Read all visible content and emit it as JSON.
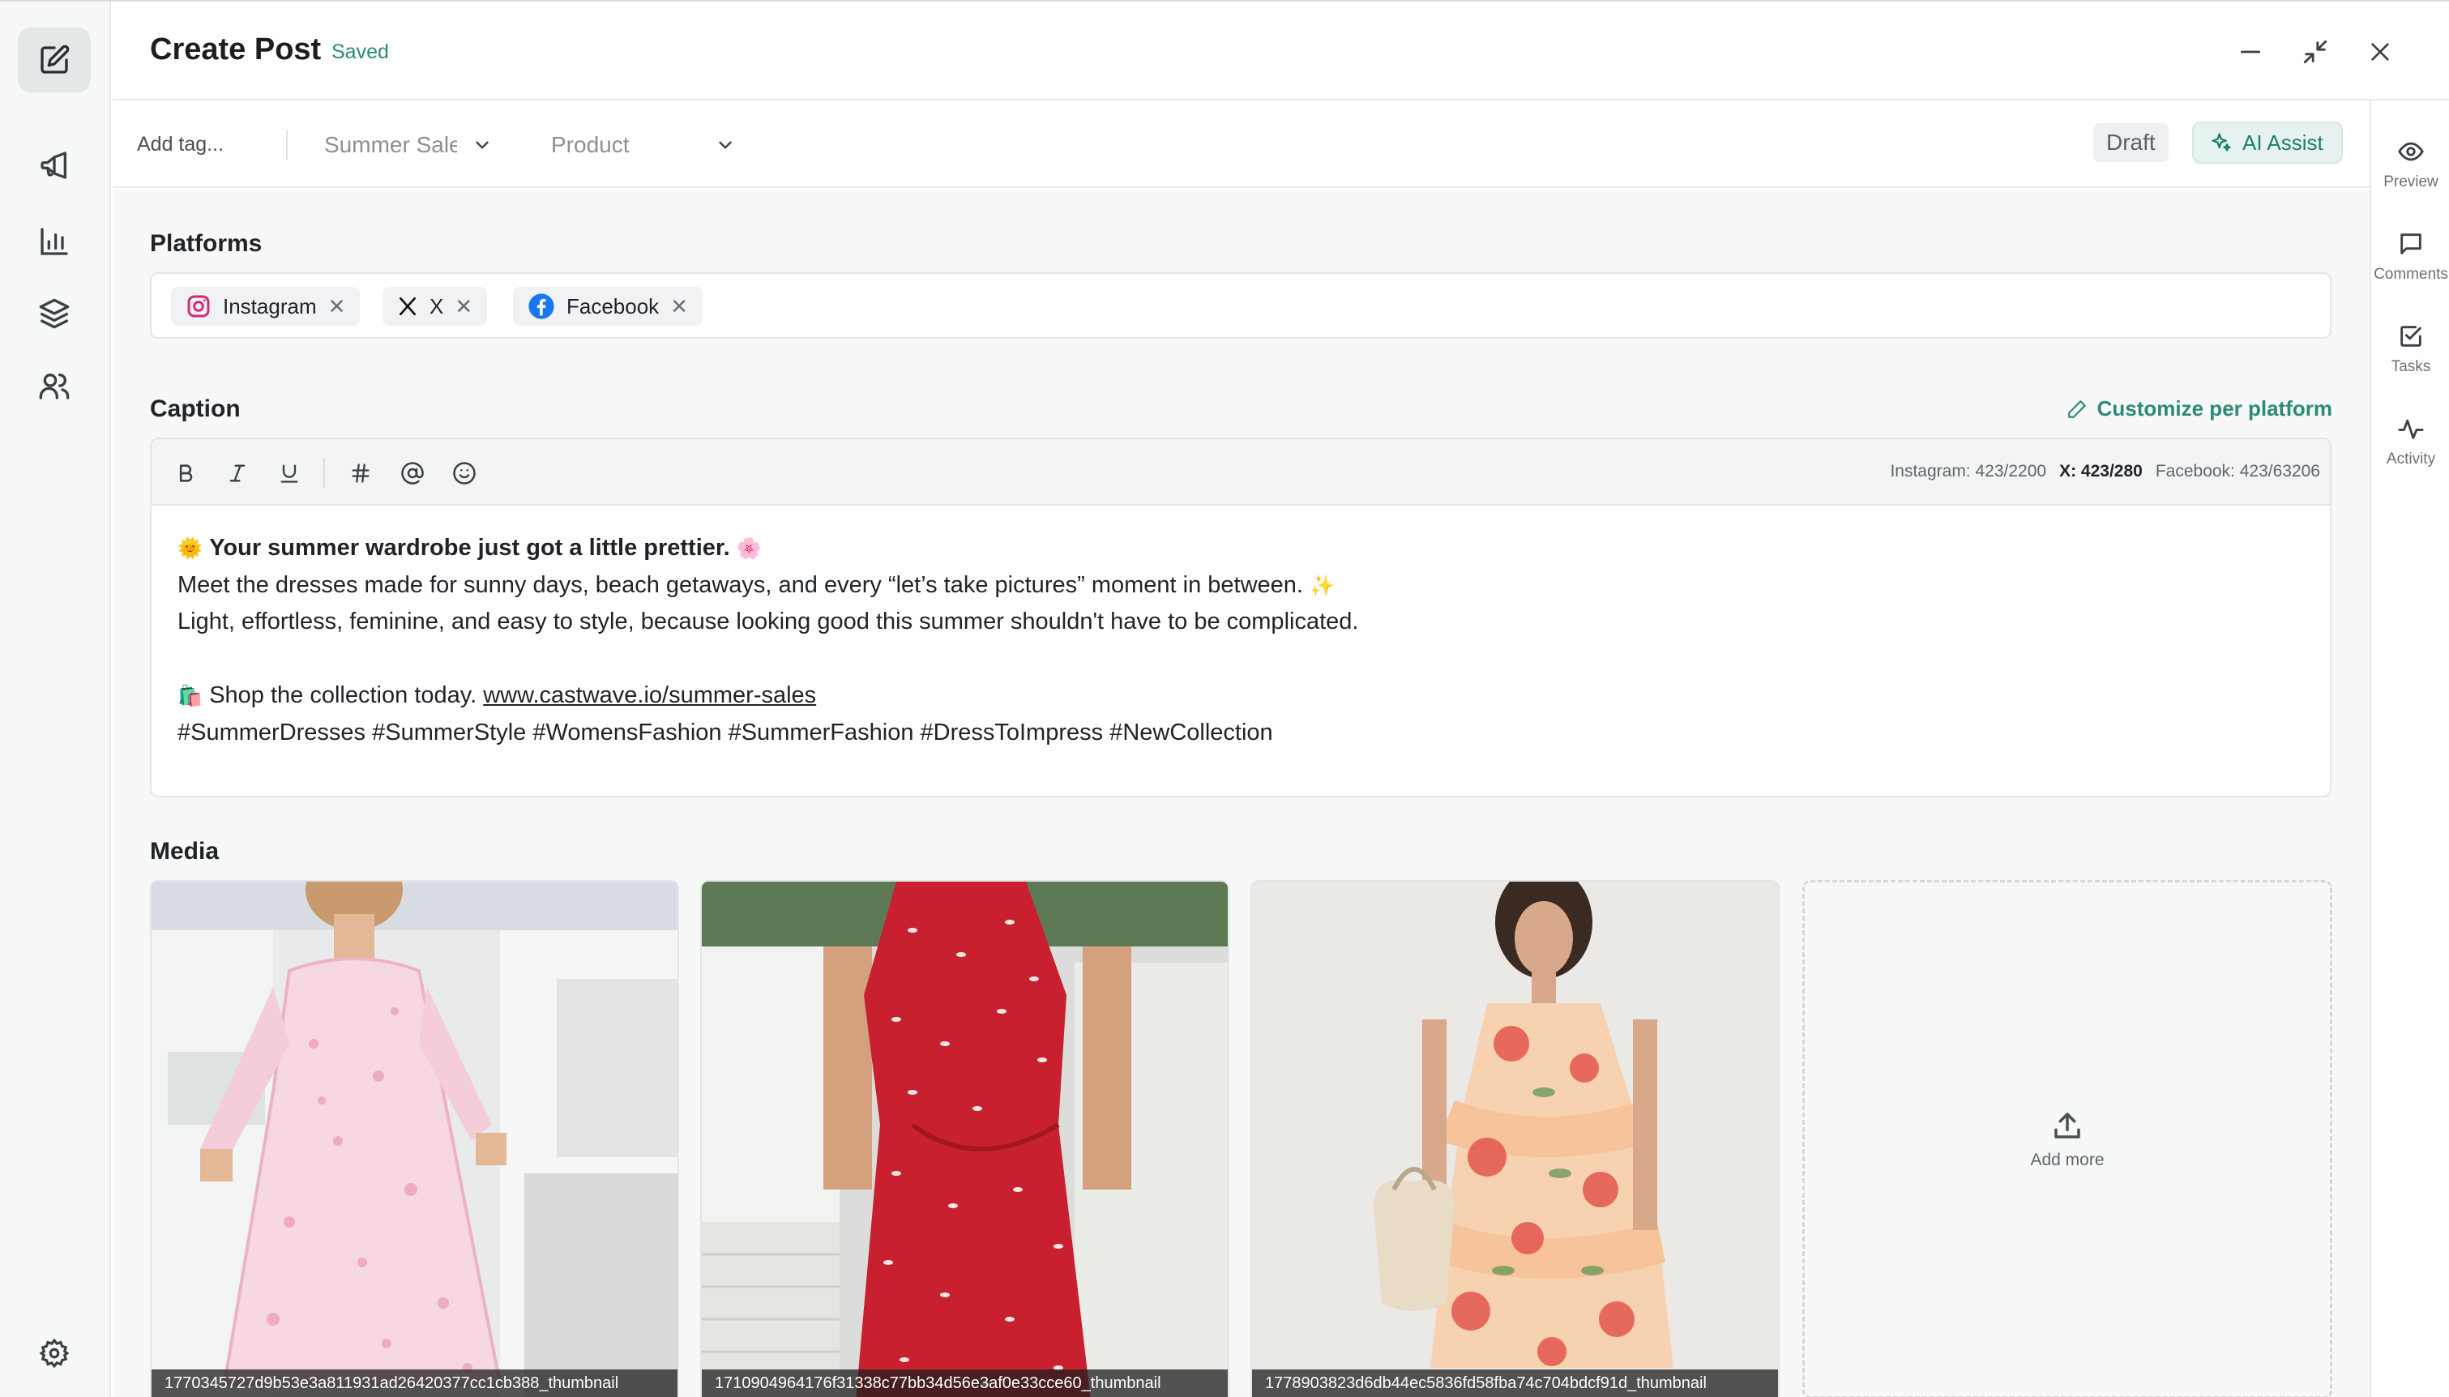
{
  "header": {
    "title": "Create Post",
    "status": "Saved"
  },
  "toolbar": {
    "tag_placeholder": "Add tag...",
    "campaign_value": "Summer Sale",
    "product_value": "Product",
    "draft_label": "Draft",
    "ai_assist_label": "AI Assist"
  },
  "right_panel": {
    "items": [
      {
        "label": "Preview",
        "icon": "eye-icon"
      },
      {
        "label": "Comments",
        "icon": "comment-icon"
      },
      {
        "label": "Tasks",
        "icon": "checkbox-icon"
      },
      {
        "label": "Activity",
        "icon": "activity-icon"
      }
    ]
  },
  "left_rail": {
    "icons": [
      "edit-icon",
      "megaphone-icon",
      "bar-chart-icon",
      "layers-icon",
      "users-icon",
      "gear-icon"
    ]
  },
  "platforms": {
    "label": "Platforms",
    "chips": [
      {
        "name": "Instagram"
      },
      {
        "name": "X"
      },
      {
        "name": "Facebook"
      }
    ]
  },
  "caption": {
    "label": "Caption",
    "customize_label": "Customize per platform",
    "counts": {
      "instagram": "Instagram: 423/2200",
      "x": "X: 423/280",
      "facebook": "Facebook: 423/63206"
    },
    "line1_emoji": "🌞",
    "line1_bold": "Your summer wardrobe just got a little prettier.",
    "line1_end_emoji": "🌸",
    "line2": "Meet the dresses made for sunny days, beach getaways, and every “let’s take pictures” moment in between.",
    "line2_emoji": "✨",
    "line3": "Light, effortless, feminine, and easy to style, because looking good this summer shouldn't have to be complicated.",
    "line5_emoji": "🛍️",
    "line5_text": "Shop the collection today.",
    "link": "www.castwave.io/summer-sales",
    "hashtags": "#SummerDresses #SummerStyle #WomensFashion #SummerFashion #DressToImpress #NewCollection"
  },
  "media": {
    "label": "Media",
    "items": [
      {
        "filename": "1770345727d9b53e3a811931ad26420377cc1cb388_thumbnail"
      },
      {
        "filename": "1710904964176f31338c77bb34d56e3af0e33cce60_thumbnail"
      },
      {
        "filename": "1778903823d6db44ec5836fd58fba74c704bdcf91d_thumbnail"
      }
    ],
    "add_more_label": "Add more"
  },
  "colors": {
    "accent": "#2c8a78",
    "rail_bg": "#f7f8f8",
    "main_bg": "#f7f8f8"
  }
}
